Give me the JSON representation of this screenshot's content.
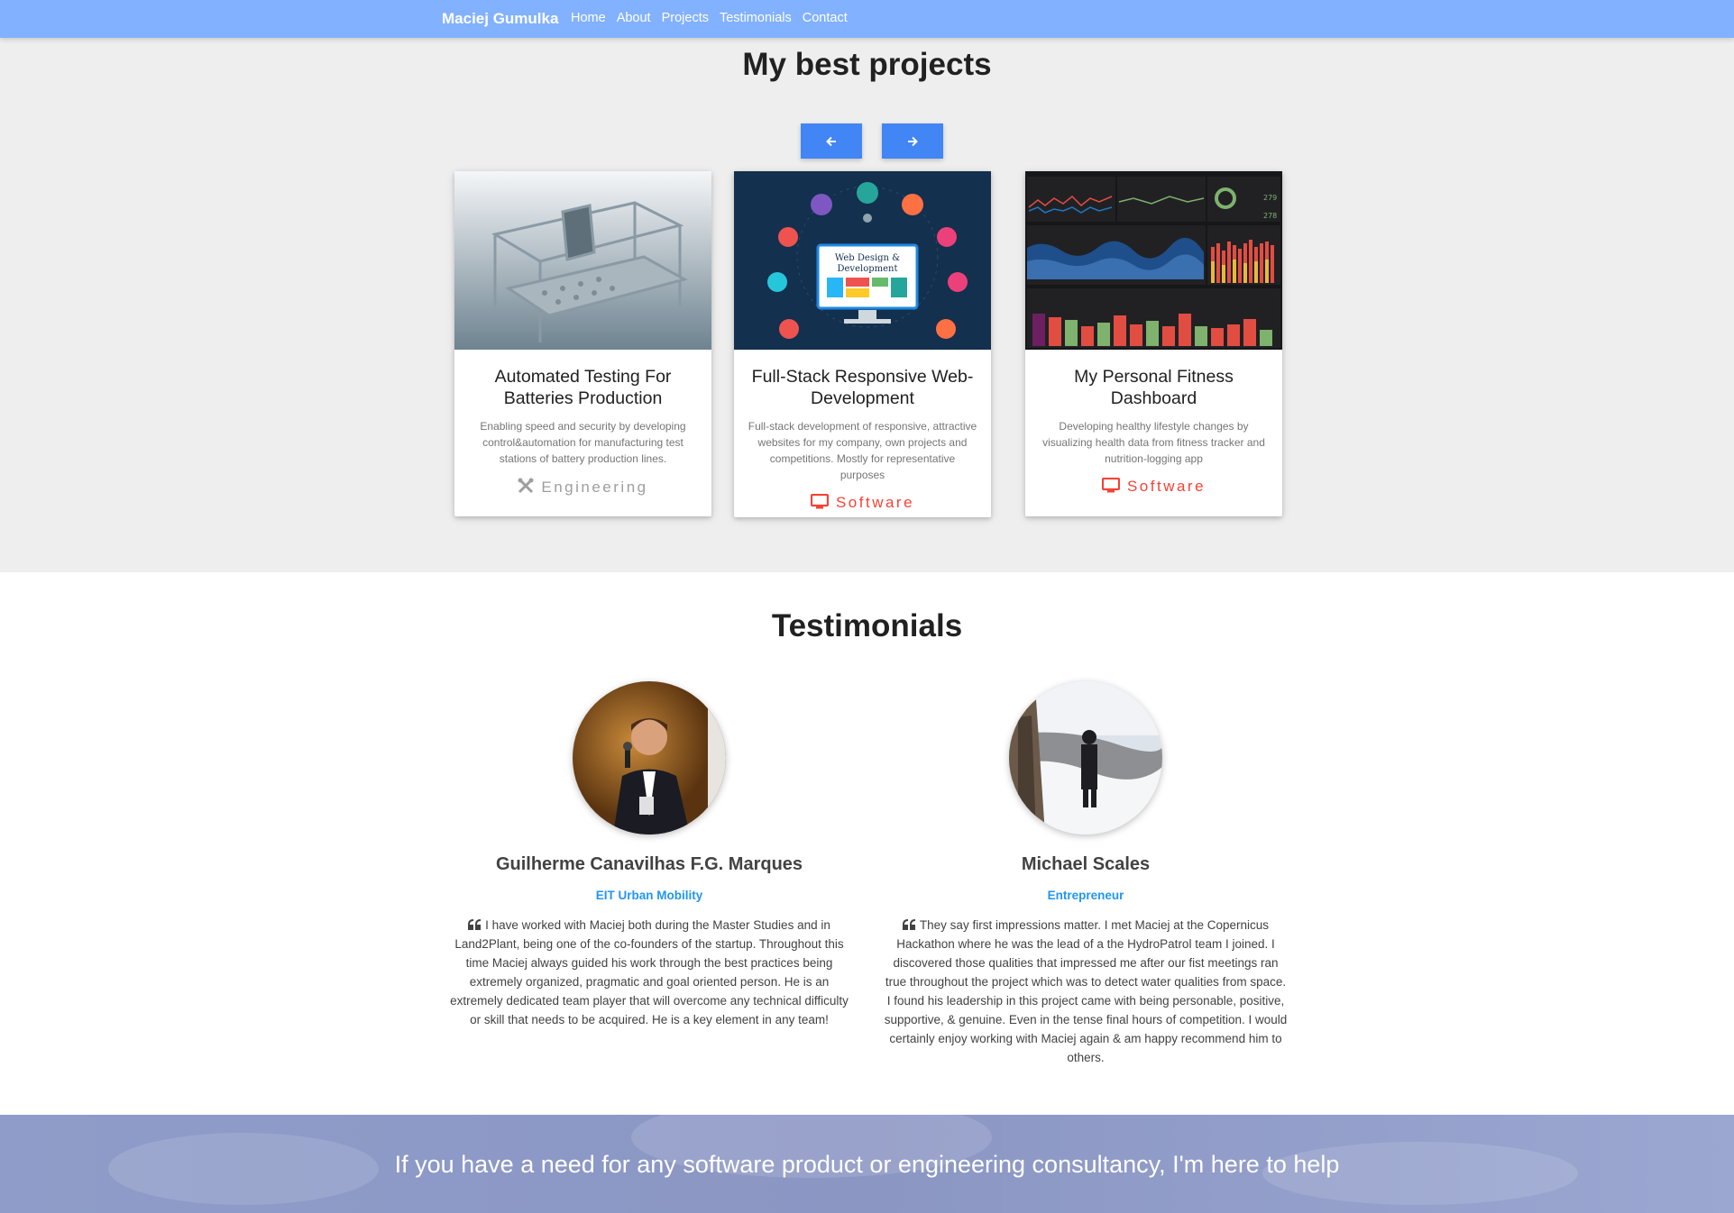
{
  "navbar": {
    "brand": "Maciej Gumulka",
    "links": [
      "Home",
      "About",
      "Projects",
      "Testimonials",
      "Contact"
    ]
  },
  "projects": {
    "title": "My best projects",
    "cards": [
      {
        "title": "Automated Testing For Batteries Production",
        "description": "Enabling speed and security by developing control&automation for manufacturing test stations of battery production lines.",
        "category": "Engineering",
        "category_icon": "tools-icon",
        "category_color": "#9e9e9e"
      },
      {
        "title": "Full-Stack Responsive Web-Development",
        "description": "Full-stack development of responsive, attractive websites for my company, own projects and competitions. Mostly for representative purposes",
        "category": "Software",
        "category_icon": "desktop-icon",
        "category_color": "#f44336",
        "image_text": "Web Design & Development"
      },
      {
        "title": "My Personal Fitness Dashboard",
        "description": "Developing healthy lifestyle changes by visualizing health data from fitness tracker and nutrition-logging app",
        "category": "Software",
        "category_icon": "desktop-icon",
        "category_color": "#f44336"
      }
    ]
  },
  "testimonials": {
    "title": "Testimonials",
    "people": [
      {
        "name": "Guilherme Canavilhas F.G. Marques",
        "role": "EIT Urban Mobility",
        "quote": "I have worked with Maciej both during the Master Studies and in Land2Plant, being one of the co-founders of the startup. Throughout this time Maciej always guided his work through the best practices being extremely organized, pragmatic and goal oriented person. He is an extremely dedicated team player that will overcome any technical difficulty or skill that needs to be acquired. He is a key element in any team!"
      },
      {
        "name": "Michael Scales",
        "role": "Entrepreneur",
        "quote": "They say first impressions matter. I met Maciej at the Copernicus Hackathon where he was the lead of a the HydroPatrol team I joined. I discovered those qualities that impressed me after our fist meetings ran true throughout the project which was to detect water qualities from space. I found his leadership in this project came with being personable, positive, supportive, & genuine. Even in the tense final hours of competition. I would certainly enjoy working with Maciej again & am happy recommend him to others."
      }
    ]
  },
  "banner": {
    "text": "If you have a need for any software product or engineering consultancy, I'm here to help"
  },
  "colors": {
    "navbar": "#82b1ff",
    "button": "#4285f4",
    "role": "#2196f3",
    "software": "#f44336"
  }
}
